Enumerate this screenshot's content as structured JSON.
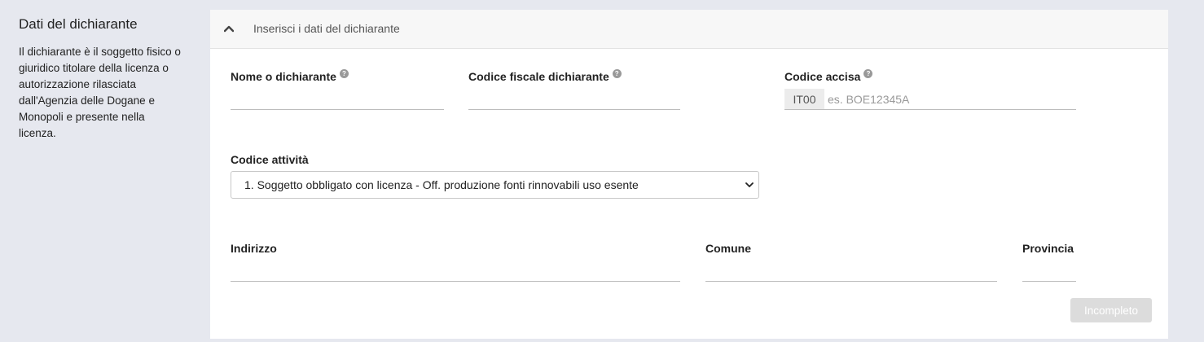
{
  "sidebar": {
    "title": "Dati del dichiarante",
    "description": "Il dichiarante è il soggetto fisico o giuridico titolare della licenza o autorizzazione rilasciata dall'Agenzia delle Dogane e Monopoli e presente nella licenza."
  },
  "panel": {
    "header_title": "Inserisci i dati del dichiarante",
    "icon": "chevron-up-icon"
  },
  "form": {
    "nome": {
      "label": "Nome o dichiarante",
      "value": ""
    },
    "codice_fiscale": {
      "label": "Codice fiscale dichiarante",
      "value": ""
    },
    "codice_accisa": {
      "label": "Codice accisa",
      "prefix": "IT00",
      "placeholder": "es. BOE12345A",
      "value": ""
    },
    "codice_attivita": {
      "label": "Codice attività",
      "selected": "1. Soggetto obbligato con licenza - Off. produzione fonti rinnovabili uso esente"
    },
    "indirizzo": {
      "label": "Indirizzo",
      "value": ""
    },
    "comune": {
      "label": "Comune",
      "value": ""
    },
    "provincia": {
      "label": "Provincia",
      "value": ""
    },
    "help_icon_glyph": "?"
  },
  "status_button": {
    "label": "Incompleto"
  },
  "colors": {
    "page_bg": "#e6e8ef",
    "panel_bg": "#ffffff",
    "button_disabled": "#dcdcdc"
  }
}
